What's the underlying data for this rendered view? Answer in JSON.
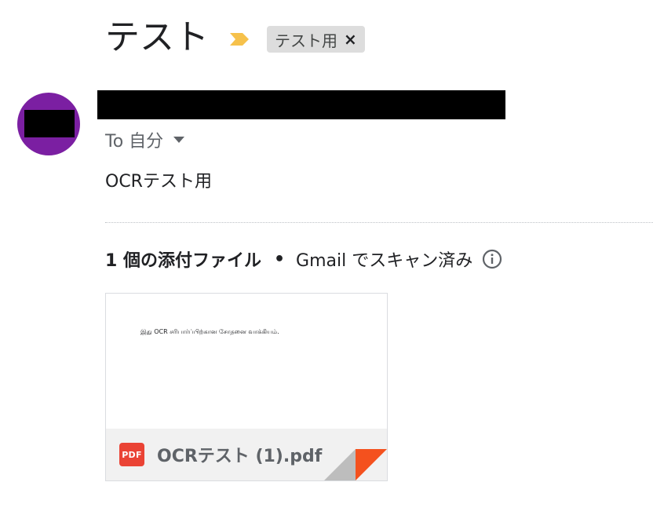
{
  "header": {
    "subject": "テスト",
    "importance_icon": "importance-marker-icon",
    "importance_color": "#f6c14b",
    "label": "テスト用",
    "label_remove": "×"
  },
  "sender": {
    "avatar_color": "#7b1fa2",
    "to_label": "To 自分",
    "to_dropdown_icon": "caret-down-icon"
  },
  "message": {
    "body": "OCRテスト用"
  },
  "attachments": {
    "count_label": "1 個の添付ファイル",
    "separator": "•",
    "scan_label": "Gmail でスキャン済み",
    "info_icon": "info-icon",
    "items": [
      {
        "preview_text": "இது OCR சரிபார்ப்பிற்கான சோதனை வாக்கியம்.",
        "type_badge": "PDF",
        "filename": "OCRテスト (1).pdf",
        "badge_color": "#ea4335",
        "corner_color": "#f4511e"
      }
    ]
  }
}
